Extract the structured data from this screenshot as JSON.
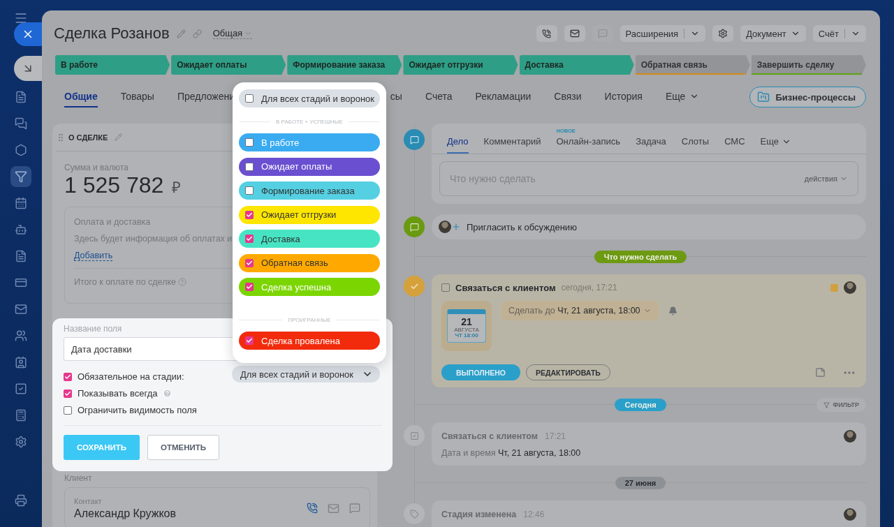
{
  "window": {
    "title": "Сделка Розанов",
    "category": "Общая"
  },
  "sidebar_items": [
    {
      "selected": false
    },
    {
      "selected": false
    },
    {
      "selected": false
    },
    {
      "selected": true
    },
    {
      "selected": false
    },
    {
      "selected": false
    },
    {
      "selected": false
    },
    {
      "selected": false
    },
    {
      "selected": false
    },
    {
      "selected": false
    },
    {
      "selected": false
    },
    {
      "selected": false
    },
    {
      "selected": false
    },
    {
      "selected": false
    }
  ],
  "header_buttons": [
    {
      "label": "Расширения",
      "split": true
    },
    {
      "label": "Документ",
      "split": false
    },
    {
      "label": "Счёт",
      "split": true
    }
  ],
  "stages": [
    {
      "label": "В работе",
      "passed": true
    },
    {
      "label": "Ожидает оплаты",
      "passed": true
    },
    {
      "label": "Формирование заказа",
      "passed": true
    },
    {
      "label": "Ожидает отгрузки",
      "passed": true
    },
    {
      "label": "Доставка",
      "passed": true
    },
    {
      "label": "Обратная связь",
      "passed": false,
      "color": "#d38a14"
    },
    {
      "label": "Завершить сделку",
      "passed": false,
      "color": "#5fa312"
    }
  ],
  "tabs": [
    {
      "label": "Общие",
      "selected": true,
      "kind": "tab"
    },
    {
      "label": "Товары",
      "selected": false,
      "kind": "tab"
    },
    {
      "label": "Предложени",
      "selected": false,
      "kind": "tab"
    },
    {
      "label": "сы",
      "selected": false,
      "kind": "tab"
    },
    {
      "label": "Счета",
      "selected": false,
      "kind": "tab"
    },
    {
      "label": "Рекламации",
      "selected": false,
      "kind": "tab"
    },
    {
      "label": "Связи",
      "selected": false,
      "kind": "tab"
    },
    {
      "label": "История",
      "selected": false,
      "kind": "tab"
    },
    {
      "label": "Еще",
      "selected": false,
      "kind": "menu"
    }
  ],
  "business_process_button": "Бизнес-процессы",
  "deal_card": {
    "title": "О СДЕЛКЕ",
    "amount_label": "Сумма и валюта",
    "amount": "1 525 782",
    "currency": "₽",
    "payment": {
      "title": "Оплата и доставка",
      "text": "Здесь будет информация об оплатах и",
      "link": "Добавить",
      "total_label": "Итого к оплате по сделке"
    },
    "client_label": "Клиент",
    "contact": {
      "label": "Контакт",
      "name": "Александр Кружков"
    }
  },
  "field_form": {
    "name_label": "Название поля",
    "name_value": "Дата доставки",
    "options": [
      {
        "label": "Обязательное на стадии:",
        "checked": true,
        "help": false
      },
      {
        "label": "Показывать всегда",
        "checked": true,
        "help": true
      },
      {
        "label": "Ограничить видимость поля",
        "checked": false,
        "help": false
      }
    ],
    "stage_select": "Для всех стадий и воронок",
    "save": "СОХРАНИТЬ",
    "cancel": "ОТМЕНИТЬ"
  },
  "stage_menu": {
    "all": {
      "label": "Для всех стадий и воронок",
      "checked": false
    },
    "groups": [
      {
        "title": "В РАБОТЕ + УСПЕШНЫЕ",
        "items": [
          {
            "label": "В работе",
            "checked": false,
            "color": "#3aabf0"
          },
          {
            "label": "Ожидает оплаты",
            "checked": false,
            "color": "#6a4fd0"
          },
          {
            "label": "Формирование заказа",
            "checked": false,
            "color": "#55d0e2"
          },
          {
            "label": "Ожидает отгрузки",
            "checked": true,
            "color": "#ffe600"
          },
          {
            "label": "Доставка",
            "checked": true,
            "color": "#47e4c4"
          },
          {
            "label": "Обратная связь",
            "checked": true,
            "color": "#ffa900"
          },
          {
            "label": "Сделка успешна",
            "checked": true,
            "color": "#7bd500"
          }
        ]
      },
      {
        "title": "ПРОИГРАННЫЕ",
        "items": [
          {
            "label": "Сделка провалена",
            "checked": true,
            "color": "#f22b0c"
          }
        ]
      }
    ]
  },
  "activity": {
    "tabs": [
      {
        "label": "Дело",
        "selected": true,
        "kind": "tab"
      },
      {
        "label": "Комментарий",
        "selected": false,
        "kind": "tab"
      },
      {
        "label": "Онлайн-запись",
        "selected": false,
        "kind": "tab",
        "badge": "НОВОЕ"
      },
      {
        "label": "Задача",
        "selected": false,
        "kind": "tab"
      },
      {
        "label": "Слоты",
        "selected": false,
        "kind": "tab"
      },
      {
        "label": "СМС",
        "selected": false,
        "kind": "tab"
      },
      {
        "label": "Еще",
        "selected": false,
        "kind": "menu"
      }
    ],
    "placeholder": "Что нужно сделать",
    "actions": "действия"
  },
  "invite": "Пригласить к обсуждению",
  "timeline": [
    {
      "kind": "separator",
      "label": "Что нужно сделать",
      "color": "#6d9a12"
    },
    {
      "kind": "task",
      "title": "Связаться с клиентом",
      "time": "сегодня, 17:21",
      "done": false,
      "calendar": {
        "day": "21",
        "month": "АВГУСТА",
        "time": "ЧТ 18:00"
      },
      "deadline": "Сделать до **Чт, 21 августа, 18:00**",
      "done_button": "ВЫПОЛНЕНО",
      "edit_button": "РЕДАКТИРОВАТЬ"
    },
    {
      "kind": "separator",
      "label": "Сегодня",
      "color": "#2a9fc9",
      "filter": "ФИЛЬТР"
    },
    {
      "kind": "task-event",
      "title": "Связаться с клиентом",
      "time": "17:21",
      "text": "Дата и время **Чт, 21 августа, 18:00**"
    },
    {
      "kind": "separator",
      "label": "27 июня",
      "color": "#8d9196"
    },
    {
      "kind": "stage-event",
      "title": "Стадия изменена",
      "time": "12:46"
    }
  ]
}
